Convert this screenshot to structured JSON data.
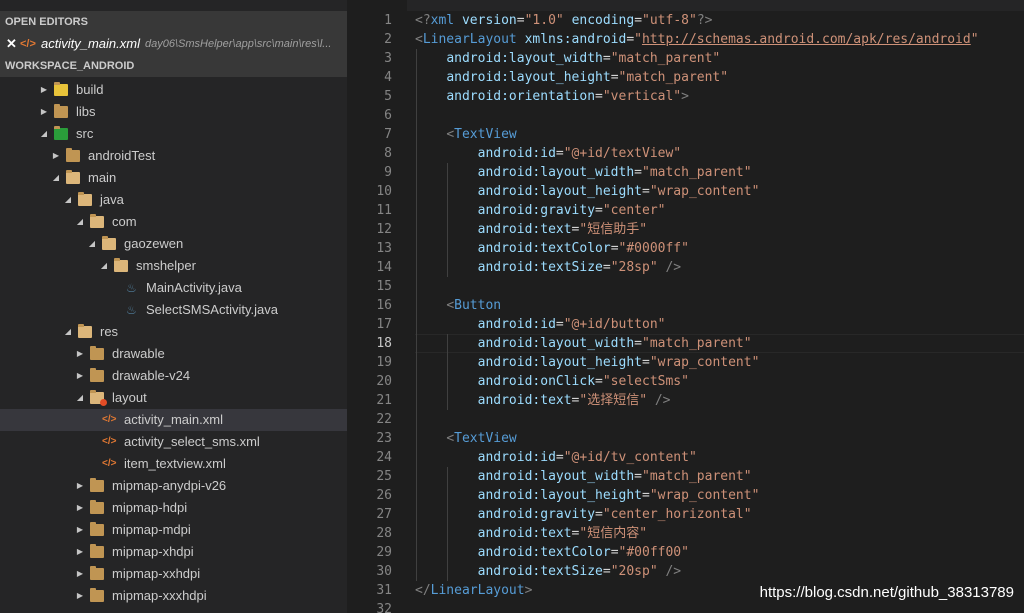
{
  "sidebar": {
    "open_editors_header": "OPEN EDITORS",
    "open_file": {
      "close_glyph": "✕",
      "icon": "xml-file-icon",
      "name": "activity_main.xml",
      "path": "day06\\SmsHelper\\app\\src\\main\\res\\l..."
    },
    "workspace_header": "WORKSPACE_ANDROID",
    "tree": [
      {
        "label": "build",
        "type": "folder",
        "expanded": false
      },
      {
        "label": "libs",
        "type": "folder",
        "expanded": false
      },
      {
        "label": "src",
        "type": "folder",
        "expanded": true
      },
      {
        "label": "androidTest",
        "type": "folder",
        "expanded": false
      },
      {
        "label": "main",
        "type": "folder",
        "expanded": true
      },
      {
        "label": "java",
        "type": "folder",
        "expanded": true
      },
      {
        "label": "com",
        "type": "folder",
        "expanded": true
      },
      {
        "label": "gaozewen",
        "type": "folder",
        "expanded": true
      },
      {
        "label": "smshelper",
        "type": "folder",
        "expanded": true
      },
      {
        "label": "MainActivity.java",
        "type": "java"
      },
      {
        "label": "SelectSMSActivity.java",
        "type": "java"
      },
      {
        "label": "res",
        "type": "folder",
        "expanded": true
      },
      {
        "label": "drawable",
        "type": "folder",
        "expanded": false
      },
      {
        "label": "drawable-v24",
        "type": "folder",
        "expanded": false
      },
      {
        "label": "layout",
        "type": "folder",
        "expanded": true
      },
      {
        "label": "activity_main.xml",
        "type": "xml",
        "selected": true
      },
      {
        "label": "activity_select_sms.xml",
        "type": "xml"
      },
      {
        "label": "item_textview.xml",
        "type": "xml"
      },
      {
        "label": "mipmap-anydpi-v26",
        "type": "folder",
        "expanded": false
      },
      {
        "label": "mipmap-hdpi",
        "type": "folder",
        "expanded": false
      },
      {
        "label": "mipmap-mdpi",
        "type": "folder",
        "expanded": false
      },
      {
        "label": "mipmap-xhdpi",
        "type": "folder",
        "expanded": false
      },
      {
        "label": "mipmap-xxhdpi",
        "type": "folder",
        "expanded": false
      },
      {
        "label": "mipmap-xxxhdpi",
        "type": "folder",
        "expanded": false
      }
    ]
  },
  "editor": {
    "active_line": 18,
    "lines": [
      [
        [
          "punct",
          "<?"
        ],
        [
          "tag",
          "xml"
        ],
        [
          "plain",
          " "
        ],
        [
          "attr",
          "version"
        ],
        [
          "plain",
          "="
        ],
        [
          "str",
          "\"1.0\""
        ],
        [
          "plain",
          " "
        ],
        [
          "attr",
          "encoding"
        ],
        [
          "plain",
          "="
        ],
        [
          "str",
          "\"utf-8\""
        ],
        [
          "punct",
          "?>"
        ]
      ],
      [
        [
          "punct",
          "<"
        ],
        [
          "tag",
          "LinearLayout"
        ],
        [
          "plain",
          " "
        ],
        [
          "attr",
          "xmlns:android"
        ],
        [
          "plain",
          "="
        ],
        [
          "str",
          "\""
        ],
        [
          "url",
          "http://schemas.android.com/apk/res/android"
        ],
        [
          "str",
          "\""
        ]
      ],
      [
        [
          "plain",
          "    "
        ],
        [
          "attr",
          "android:layout_width"
        ],
        [
          "plain",
          "="
        ],
        [
          "str",
          "\"match_parent\""
        ]
      ],
      [
        [
          "plain",
          "    "
        ],
        [
          "attr",
          "android:layout_height"
        ],
        [
          "plain",
          "="
        ],
        [
          "str",
          "\"match_parent\""
        ]
      ],
      [
        [
          "plain",
          "    "
        ],
        [
          "attr",
          "android:orientation"
        ],
        [
          "plain",
          "="
        ],
        [
          "str",
          "\"vertical\""
        ],
        [
          "punct",
          ">"
        ]
      ],
      [],
      [
        [
          "plain",
          "    "
        ],
        [
          "punct",
          "<"
        ],
        [
          "tag",
          "TextView"
        ]
      ],
      [
        [
          "plain",
          "        "
        ],
        [
          "attr",
          "android:id"
        ],
        [
          "plain",
          "="
        ],
        [
          "str",
          "\"@+id/textView\""
        ]
      ],
      [
        [
          "plain",
          "        "
        ],
        [
          "attr",
          "android:layout_width"
        ],
        [
          "plain",
          "="
        ],
        [
          "str",
          "\"match_parent\""
        ]
      ],
      [
        [
          "plain",
          "        "
        ],
        [
          "attr",
          "android:layout_height"
        ],
        [
          "plain",
          "="
        ],
        [
          "str",
          "\"wrap_content\""
        ]
      ],
      [
        [
          "plain",
          "        "
        ],
        [
          "attr",
          "android:gravity"
        ],
        [
          "plain",
          "="
        ],
        [
          "str",
          "\"center\""
        ]
      ],
      [
        [
          "plain",
          "        "
        ],
        [
          "attr",
          "android:text"
        ],
        [
          "plain",
          "="
        ],
        [
          "str",
          "\"短信助手\""
        ]
      ],
      [
        [
          "plain",
          "        "
        ],
        [
          "attr",
          "android:textColor"
        ],
        [
          "plain",
          "="
        ],
        [
          "str",
          "\"#0000ff\""
        ]
      ],
      [
        [
          "plain",
          "        "
        ],
        [
          "attr",
          "android:textSize"
        ],
        [
          "plain",
          "="
        ],
        [
          "str",
          "\"28sp\""
        ],
        [
          "plain",
          " "
        ],
        [
          "punct",
          "/>"
        ]
      ],
      [],
      [
        [
          "plain",
          "    "
        ],
        [
          "punct",
          "<"
        ],
        [
          "tag",
          "Button"
        ]
      ],
      [
        [
          "plain",
          "        "
        ],
        [
          "attr",
          "android:id"
        ],
        [
          "plain",
          "="
        ],
        [
          "str",
          "\"@+id/button\""
        ]
      ],
      [
        [
          "plain",
          "        "
        ],
        [
          "attr",
          "android:layout_width"
        ],
        [
          "plain",
          "="
        ],
        [
          "str",
          "\"match_parent\""
        ]
      ],
      [
        [
          "plain",
          "        "
        ],
        [
          "attr",
          "android:layout_height"
        ],
        [
          "plain",
          "="
        ],
        [
          "str",
          "\"wrap_content\""
        ]
      ],
      [
        [
          "plain",
          "        "
        ],
        [
          "attr",
          "android:onClick"
        ],
        [
          "plain",
          "="
        ],
        [
          "str",
          "\"selectSms\""
        ]
      ],
      [
        [
          "plain",
          "        "
        ],
        [
          "attr",
          "android:text"
        ],
        [
          "plain",
          "="
        ],
        [
          "str",
          "\"选择短信\""
        ],
        [
          "plain",
          " "
        ],
        [
          "punct",
          "/>"
        ]
      ],
      [],
      [
        [
          "plain",
          "    "
        ],
        [
          "punct",
          "<"
        ],
        [
          "tag",
          "TextView"
        ]
      ],
      [
        [
          "plain",
          "        "
        ],
        [
          "attr",
          "android:id"
        ],
        [
          "plain",
          "="
        ],
        [
          "str",
          "\"@+id/tv_content\""
        ]
      ],
      [
        [
          "plain",
          "        "
        ],
        [
          "attr",
          "android:layout_width"
        ],
        [
          "plain",
          "="
        ],
        [
          "str",
          "\"match_parent\""
        ]
      ],
      [
        [
          "plain",
          "        "
        ],
        [
          "attr",
          "android:layout_height"
        ],
        [
          "plain",
          "="
        ],
        [
          "str",
          "\"wrap_content\""
        ]
      ],
      [
        [
          "plain",
          "        "
        ],
        [
          "attr",
          "android:gravity"
        ],
        [
          "plain",
          "="
        ],
        [
          "str",
          "\"center_horizontal\""
        ]
      ],
      [
        [
          "plain",
          "        "
        ],
        [
          "attr",
          "android:text"
        ],
        [
          "plain",
          "="
        ],
        [
          "str",
          "\"短信内容\""
        ]
      ],
      [
        [
          "plain",
          "        "
        ],
        [
          "attr",
          "android:textColor"
        ],
        [
          "plain",
          "="
        ],
        [
          "str",
          "\"#00ff00\""
        ]
      ],
      [
        [
          "plain",
          "        "
        ],
        [
          "attr",
          "android:textSize"
        ],
        [
          "plain",
          "="
        ],
        [
          "str",
          "\"20sp\""
        ],
        [
          "plain",
          " "
        ],
        [
          "punct",
          "/>"
        ]
      ],
      [
        [
          "punct",
          "</"
        ],
        [
          "tag",
          "LinearLayout"
        ],
        [
          "punct",
          ">"
        ]
      ],
      []
    ],
    "line_numbers": [
      "1",
      "2",
      "3",
      "4",
      "5",
      "6",
      "7",
      "8",
      "9",
      "10",
      "11",
      "12",
      "13",
      "14",
      "15",
      "16",
      "17",
      "18",
      "19",
      "20",
      "21",
      "22",
      "23",
      "24",
      "25",
      "26",
      "27",
      "28",
      "29",
      "30",
      "31",
      "32"
    ]
  },
  "watermark": "https://blog.csdn.net/github_38313789",
  "colors": {
    "background": "#1e1e1e",
    "sidebar": "#252526",
    "section_header": "#383838",
    "selected_row": "#37373d",
    "tag": "#569cd6",
    "attribute": "#9cdcfe",
    "string": "#ce9178",
    "punctuation": "#808080",
    "folder": "#c09553",
    "xml_icon": "#e37933",
    "java_icon": "#5382a1"
  }
}
